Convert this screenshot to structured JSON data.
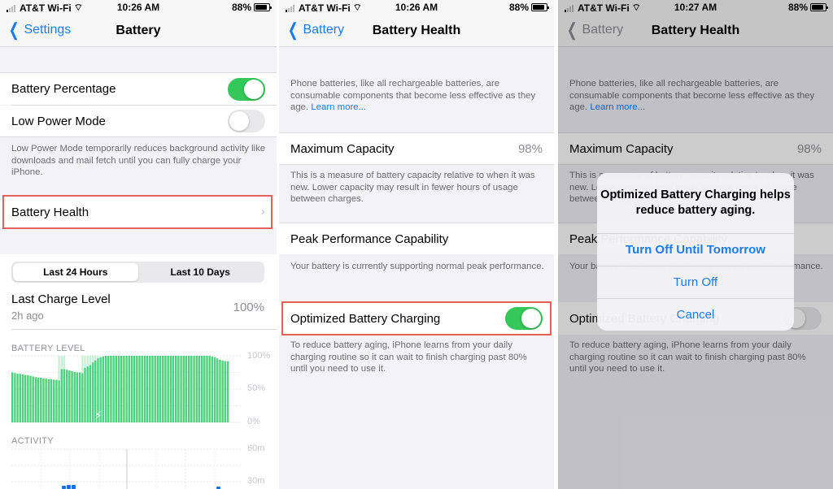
{
  "colors": {
    "accent": "#1a7cf0",
    "toggle_on": "#34c759",
    "highlight": "#e4615a",
    "bar_fill": "#4cd27a",
    "bar_charging": "#a7e6bb",
    "activity": "#1a6fe0"
  },
  "panels": [
    {
      "status": {
        "carrier": "AT&T Wi-Fi",
        "time": "10:26 AM",
        "battery": "88%"
      },
      "nav": {
        "back": "Settings",
        "title": "Battery"
      },
      "battery_percentage": {
        "label": "Battery Percentage",
        "on": true
      },
      "low_power_mode": {
        "label": "Low Power Mode",
        "on": false
      },
      "low_power_footer": "Low Power Mode temporarily reduces background activity like downloads and mail fetch until you can fully charge your iPhone.",
      "battery_health": {
        "label": "Battery Health"
      },
      "segments": [
        "Last 24 Hours",
        "Last 10 Days"
      ],
      "selected_segment": "Last 24 Hours",
      "last_charge": {
        "label": "Last Charge Level",
        "sub": "2h ago",
        "value": "100%"
      },
      "battery_level_label": "BATTERY LEVEL",
      "activity_label": "ACTIVITY"
    },
    {
      "status": {
        "carrier": "AT&T Wi-Fi",
        "time": "10:26 AM",
        "battery": "88%"
      },
      "nav": {
        "back": "Battery",
        "title": "Battery Health"
      },
      "intro": "Phone batteries, like all rechargeable batteries, are consumable components that become less effective as they age.",
      "learn_more": "Learn more...",
      "max_capacity": {
        "label": "Maximum Capacity",
        "value": "98%"
      },
      "max_capacity_footer": "This is a measure of battery capacity relative to when it was new. Lower capacity may result in fewer hours of usage between charges.",
      "peak": {
        "label": "Peak Performance Capability"
      },
      "peak_footer": "Your battery is currently supporting normal peak performance.",
      "optimized": {
        "label": "Optimized Battery Charging",
        "on": true
      },
      "optimized_footer": "To reduce battery aging, iPhone learns from your daily charging routine so it can wait to finish charging past 80% until you need to use it."
    },
    {
      "status": {
        "carrier": "AT&T Wi-Fi",
        "time": "10:27 AM",
        "battery": "88%"
      },
      "nav": {
        "back": "Battery",
        "title": "Battery Health"
      },
      "intro": "Phone batteries, like all rechargeable batteries, are consumable components that become less effective as they age.",
      "learn_more": "Learn more...",
      "max_capacity": {
        "label": "Maximum Capacity",
        "value": "98%"
      },
      "max_capacity_footer": "This is a measure of battery capacity relative to when it was new. Lower capacity may result in fewer hours of usage between charges.",
      "peak": {
        "label": "Peak Performance Capability"
      },
      "peak_footer": "Your battery is currently supporting normal peak performance.",
      "optimized": {
        "label": "Optimized Battery Charging",
        "on": false
      },
      "optimized_footer": "To reduce battery aging, iPhone learns from your daily charging routine so it can wait to finish charging past 80% until you need to use it.",
      "alert": {
        "title": "Optimized Battery Charging helps reduce battery aging.",
        "buttons": [
          "Turn Off Until Tomorrow",
          "Turn Off",
          "Cancel"
        ]
      }
    }
  ],
  "chart_data": [
    {
      "type": "bar",
      "title": "BATTERY LEVEL",
      "ylabel": "",
      "ylim": [
        0,
        100
      ],
      "yticks": [
        "100%",
        "50%",
        "0%"
      ],
      "grid": true,
      "values": [
        75,
        74,
        73,
        73,
        72,
        71,
        71,
        70,
        69,
        68,
        67,
        67,
        66,
        66,
        65,
        65,
        64,
        64,
        63,
        80,
        80,
        79,
        78,
        77,
        76,
        75,
        75,
        74,
        82,
        84,
        86,
        90,
        93,
        96,
        98,
        99,
        100,
        100,
        100,
        100,
        100,
        100,
        100,
        100,
        100,
        100,
        100,
        100,
        100,
        100,
        100,
        100,
        100,
        100,
        100,
        100,
        100,
        100,
        100,
        100,
        100,
        100,
        100,
        100,
        100,
        100,
        100,
        100,
        100,
        100,
        100,
        100,
        100,
        100,
        100,
        100,
        100,
        99,
        98,
        96,
        94,
        93,
        92,
        92
      ],
      "charging_ranges": [
        [
          18,
          20
        ],
        [
          27,
          29
        ],
        [
          30,
          33
        ]
      ]
    },
    {
      "type": "bar",
      "title": "ACTIVITY",
      "ylim": [
        0,
        60
      ],
      "yticks": [
        "60m",
        "30m"
      ],
      "grid": true
    }
  ]
}
